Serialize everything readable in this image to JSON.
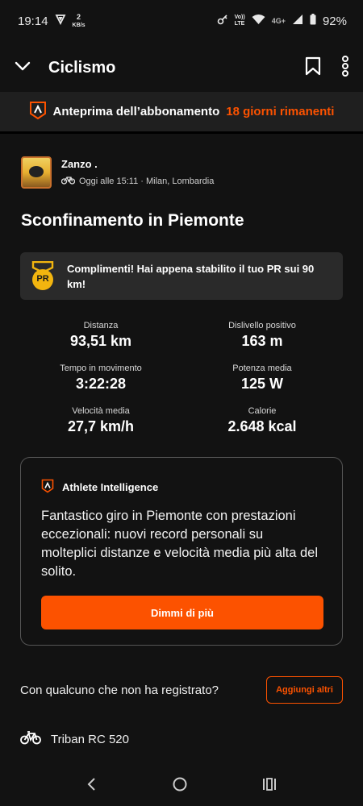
{
  "status_bar": {
    "time": "19:14",
    "data_rate_value": "2",
    "data_rate_unit": "KB/s",
    "network_top": "Vo))",
    "network_bottom": "LTE",
    "network_type": "4G+",
    "battery": "92%"
  },
  "header": {
    "title": "Ciclismo"
  },
  "banner": {
    "text": "Anteprima dell’abbonamento",
    "highlight": "18 giorni rimanenti"
  },
  "athlete": {
    "name": "Zanzo .",
    "meta": "Oggi alle 15:11 · Milan, Lombardia"
  },
  "activity": {
    "title": "Sconfinamento in Piemonte"
  },
  "pr": {
    "badge": "PR",
    "text": "Complimenti! Hai appena stabilito il tuo PR sui 90 km!"
  },
  "stats": [
    {
      "label": "Distanza",
      "value": "93,51 km"
    },
    {
      "label": "Dislivello positivo",
      "value": "163 m"
    },
    {
      "label": "Tempo in movimento",
      "value": "3:22:28"
    },
    {
      "label": "Potenza media",
      "value": "125 W"
    },
    {
      "label": "Velocità media",
      "value": "27,7 km/h"
    },
    {
      "label": "Calorie",
      "value": "2.648 kcal"
    }
  ],
  "ai": {
    "title": "Athlete Intelligence",
    "body": "Fantastico giro in Piemonte con prestazioni eccezionali: nuovi record personali su molteplici distanze e velocità media più alta del solito.",
    "button": "Dimmi di più"
  },
  "with_others": {
    "text": "Con qualcuno che non ha registrato?",
    "button": "Aggiungi altri"
  },
  "gear": {
    "name": "Triban RC 520"
  },
  "colors": {
    "accent": "#fc5200",
    "background": "#121212",
    "card": "#2a2a2a"
  }
}
